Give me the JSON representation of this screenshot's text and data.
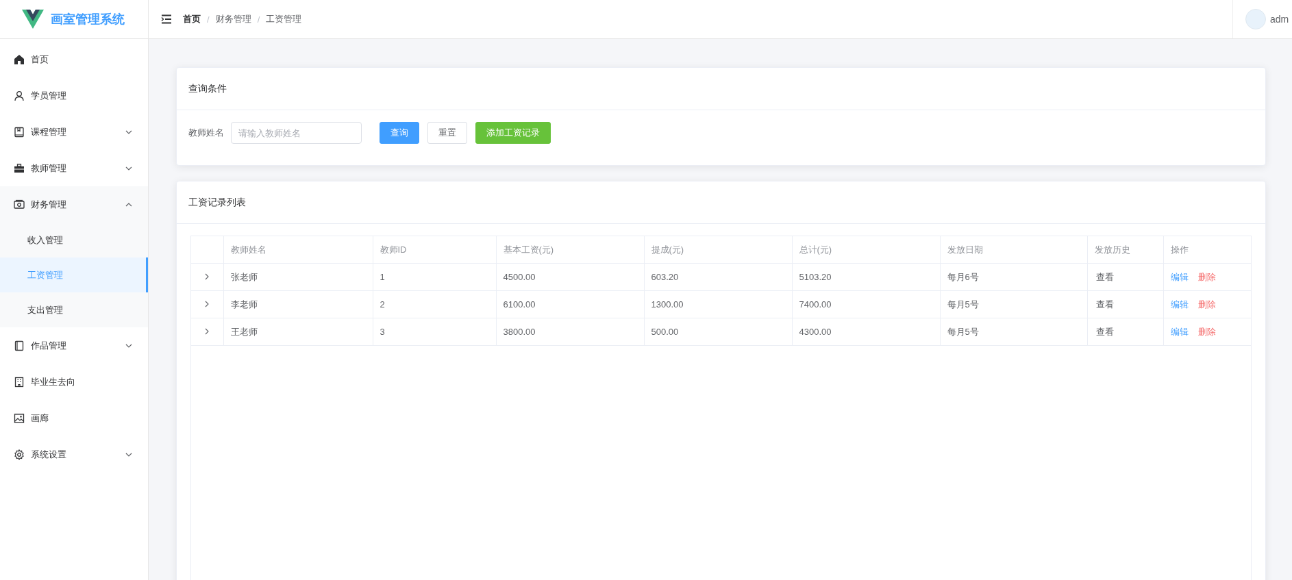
{
  "app": {
    "title": "画室管理系统"
  },
  "header": {
    "breadcrumb": [
      {
        "label": "首页"
      },
      {
        "separator": "/",
        "label": "财务管理"
      },
      {
        "separator": "/",
        "label": "工资管理"
      }
    ],
    "user": "adm"
  },
  "sidebar": {
    "items": [
      {
        "label": "首页",
        "selected": false
      },
      {
        "label": "学员管理",
        "selected": false
      },
      {
        "label": "课程管理",
        "selected": false,
        "expanded": false
      },
      {
        "label": "教师管理",
        "selected": false,
        "expanded": false
      },
      {
        "label": "财务管理",
        "selected": false,
        "expanded": true,
        "children": [
          {
            "label": "收入管理",
            "selected": false
          },
          {
            "label": "工资管理",
            "selected": true
          },
          {
            "label": "支出管理",
            "selected": false
          }
        ]
      },
      {
        "label": "作品管理",
        "selected": false,
        "expanded": false
      },
      {
        "label": "毕业生去向",
        "selected": false
      },
      {
        "label": "画廊",
        "selected": false
      },
      {
        "label": "系统设置",
        "selected": false,
        "expanded": false
      }
    ]
  },
  "query_card": {
    "title": "查询条件",
    "field_label": "教师姓名",
    "placeholder": "请输入教师姓名",
    "buttons": [
      {
        "label": "查询",
        "kind": "primary"
      },
      {
        "label": "重置",
        "kind": "default"
      },
      {
        "label": "添加工资记录",
        "kind": "success"
      }
    ]
  },
  "table_card": {
    "title": "工资记录列表"
  },
  "table": {
    "columns": [
      "教师姓名",
      "教师ID",
      "基本工资(元)",
      "提成(元)",
      "总计(元)",
      "发放日期",
      "发放历史",
      "操作"
    ],
    "rows": [
      {
        "expanded": false,
        "cells": [
          "张老师",
          "1",
          "4500.00",
          "603.20",
          "5103.20",
          "每月6号"
        ],
        "history": "查看",
        "actions": [
          "编辑",
          "删除"
        ]
      },
      {
        "expanded": false,
        "cells": [
          "李老师",
          "2",
          "6100.00",
          "1300.00",
          "7400.00",
          "每月5号"
        ],
        "history": "查看",
        "actions": [
          "编辑",
          "删除"
        ]
      },
      {
        "expanded": false,
        "cells": [
          "王老师",
          "3",
          "3800.00",
          "500.00",
          "4300.00",
          "每月5号"
        ],
        "history": "查看",
        "actions": [
          "编辑",
          "删除"
        ]
      }
    ]
  }
}
